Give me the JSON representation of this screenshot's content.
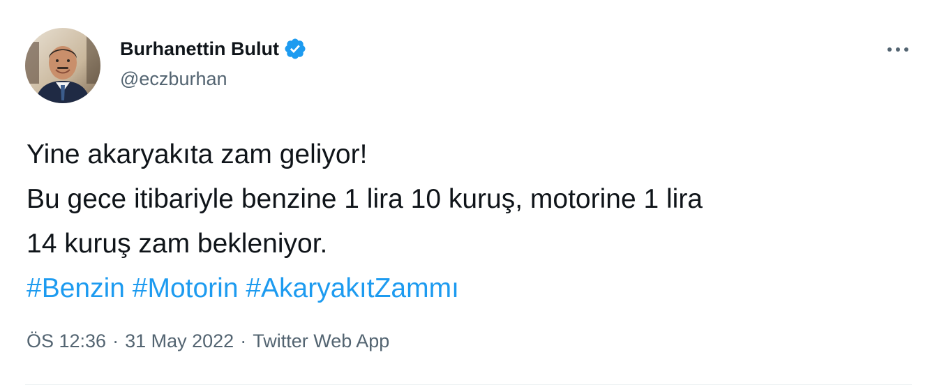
{
  "colors": {
    "text": "#0f1419",
    "secondary": "#536471",
    "accent": "#1d9bf0"
  },
  "author": {
    "avatar_icon": "profile-photo",
    "display_name": "Burhanettin Bulut",
    "verified_icon": "verified-badge-icon",
    "handle": "@eczburhan"
  },
  "actions": {
    "more_icon": "more-horizontal-icon"
  },
  "tweet": {
    "lines": [
      "Yine akaryakıta zam geliyor!",
      "Bu gece itibariyle benzine 1 lira 10 kuruş, motorine 1 lira",
      "14 kuruş zam bekleniyor."
    ],
    "hashtags": [
      "#Benzin",
      "#Motorin",
      "#AkaryakıtZammı"
    ]
  },
  "meta": {
    "time": "ÖS 12:36",
    "separator": "·",
    "date": "31 May 2022",
    "source": "Twitter Web App"
  }
}
